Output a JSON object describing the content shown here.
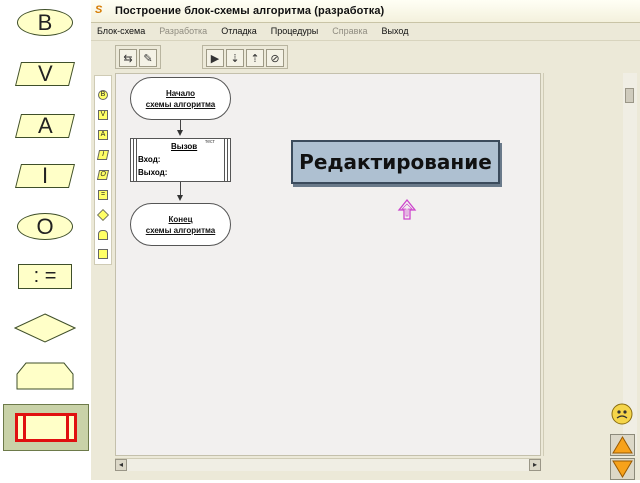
{
  "palette": {
    "buttons": [
      {
        "label": "B",
        "shape": "oval"
      },
      {
        "label": "V",
        "shape": "parallelogram"
      },
      {
        "label": "A",
        "shape": "parallelogram"
      },
      {
        "label": "I",
        "shape": "parallelogram"
      },
      {
        "label": "O",
        "shape": "oval"
      },
      {
        "label": ": =",
        "shape": "rectangle"
      },
      {
        "label": "",
        "shape": "diamond"
      },
      {
        "label": "",
        "shape": "loop-hexagon"
      },
      {
        "label": "",
        "shape": "subroutine"
      }
    ]
  },
  "window": {
    "title": "Построение блок-схемы алгоритма (разработка)",
    "menu": [
      {
        "label": "Блок-схема",
        "enabled": true
      },
      {
        "label": "Разработка",
        "enabled": false
      },
      {
        "label": "Отладка",
        "enabled": true
      },
      {
        "label": "Процедуры",
        "enabled": true
      },
      {
        "label": "Справка",
        "enabled": false
      },
      {
        "label": "Выход",
        "enabled": true
      }
    ]
  },
  "flowchart": {
    "start_line1": "Начало",
    "start_line2": "схемы алгоритма",
    "call_title": "Вызов",
    "call_note": "тест",
    "call_input": "Вход:",
    "call_output": "Выход:",
    "end_line1": "Конец",
    "end_line2": "схемы алгоритма"
  },
  "banner": {
    "text": "Редактирование"
  },
  "colors": {
    "palette_fill": "#ffffc8",
    "banner_fill": "#aec0d1",
    "arrow_fill": "#f7a21b",
    "cursor": "#cc44cc"
  }
}
